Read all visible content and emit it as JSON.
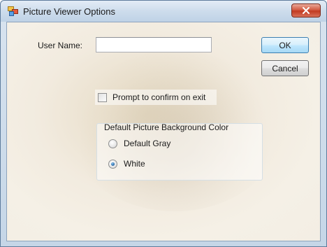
{
  "window": {
    "title": "Picture Viewer Options",
    "close_icon": "close-icon"
  },
  "form": {
    "user_name_label": "User Name:",
    "user_name_value": "",
    "ok_label": "OK",
    "cancel_label": "Cancel",
    "prompt_checkbox_label": "Prompt to confirm on exit",
    "prompt_checked": false
  },
  "background_color": {
    "group_title": "Default Picture Background Color",
    "options": [
      {
        "label": "Default Gray",
        "selected": false
      },
      {
        "label": "White",
        "selected": true
      }
    ]
  }
}
